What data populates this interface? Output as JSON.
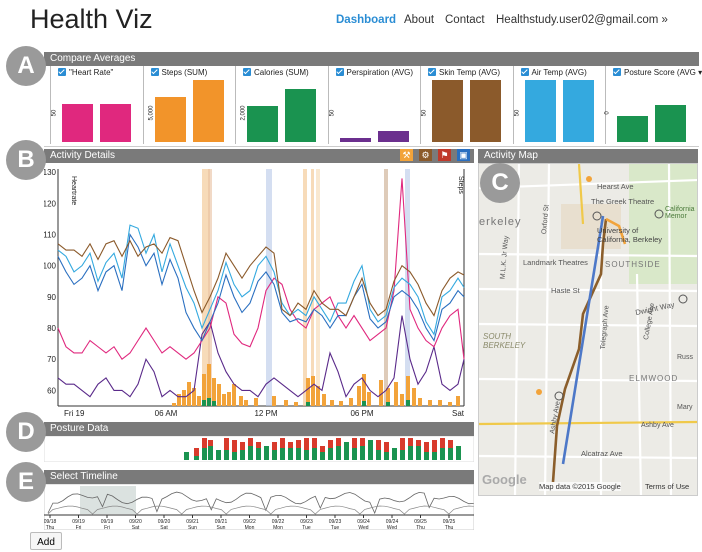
{
  "app": {
    "title": "Health Viz"
  },
  "nav": {
    "dashboard": "Dashboard",
    "about": "About",
    "contact": "Contact",
    "user": "Healthstudy.user02@gmail.com »"
  },
  "sections": {
    "A": "A",
    "B": "B",
    "C": "C",
    "D": "D",
    "E": "E"
  },
  "compare": {
    "header": "Compare Averages",
    "metrics": [
      {
        "label": "\"Heart Rate\"",
        "color": "#e0287e",
        "values": [
          0.62,
          0.62
        ]
      },
      {
        "label": "Steps (SUM)",
        "color": "#f2942a",
        "values": [
          0.72,
          1.0
        ]
      },
      {
        "label": "Calories (SUM)",
        "color": "#1a9350",
        "values": [
          0.58,
          0.85
        ]
      },
      {
        "label": "Perspiration (AVG)",
        "color": "#6b2f8e",
        "values": [
          0.06,
          0.18
        ]
      },
      {
        "label": "Skin Temp (AVG)",
        "color": "#8b5a2b",
        "values": [
          1.0,
          1.0
        ]
      },
      {
        "label": "Air Temp (AVG)",
        "color": "#34a9df",
        "values": [
          1.0,
          1.0
        ]
      },
      {
        "label": "Posture Score (AVG ▾",
        "color": "#1a9350",
        "values": [
          0.42,
          0.6
        ]
      }
    ],
    "axis_ticks": [
      "50",
      "5,000",
      "2,000",
      "50",
      "50",
      "50",
      "0"
    ]
  },
  "activity": {
    "header": "Activity Details",
    "left_axis_label": "Heartrate",
    "right_axis_label": "Steps",
    "y_ticks": [
      "130",
      "120",
      "110",
      "100",
      "90",
      "80",
      "70",
      "60"
    ],
    "x_ticks": [
      "Fri 19",
      "06 AM",
      "12 PM",
      "06 PM",
      "Sat"
    ],
    "activity_icons": [
      {
        "name": "walk-icon",
        "glyph": "⚒",
        "color": "#f2a33a"
      },
      {
        "name": "bike-icon",
        "glyph": "⚙",
        "color": "#8b5a2b"
      },
      {
        "name": "run-icon",
        "glyph": "⚑",
        "color": "#c0392b"
      },
      {
        "name": "car-icon",
        "glyph": "▣",
        "color": "#2a6fc0"
      }
    ]
  },
  "map": {
    "header": "Activity Map",
    "labels": [
      "Hearst Ave",
      "The Greek Theatre",
      "Oxford St",
      "University of California, Berkeley",
      "California Memor",
      "Landmark Theatres",
      "SOUTHSIDE",
      "erkeley",
      "M.L.K. Jr Way",
      "Haste St",
      "Dwight Way",
      "College Ave",
      "Telegraph Ave",
      "SOUTH BERKELEY",
      "ELMWOOD",
      "Alcatraz Ave",
      "Ashby Ave",
      "Russ",
      "Mary",
      "Ashby Ave"
    ],
    "attribution": "Map data ©2015 Google",
    "terms": "Terms of Use",
    "logo": "Google"
  },
  "posture": {
    "header": "Posture Data"
  },
  "timeline": {
    "header": "Select Timeline",
    "dates": [
      {
        "d": "09/18",
        "w": "Thu"
      },
      {
        "d": "09/19",
        "w": "Fri"
      },
      {
        "d": "09/19",
        "w": "Fri"
      },
      {
        "d": "09/20",
        "w": "Sat"
      },
      {
        "d": "09/20",
        "w": "Sat"
      },
      {
        "d": "09/21",
        "w": "Sun"
      },
      {
        "d": "09/21",
        "w": "Sun"
      },
      {
        "d": "09/22",
        "w": "Mon"
      },
      {
        "d": "09/22",
        "w": "Mon"
      },
      {
        "d": "09/23",
        "w": "Tue"
      },
      {
        "d": "09/23",
        "w": "Tue"
      },
      {
        "d": "09/24",
        "w": "Wed"
      },
      {
        "d": "09/24",
        "w": "Wed"
      },
      {
        "d": "09/25",
        "w": "Thu"
      },
      {
        "d": "09/25",
        "w": "Thu"
      }
    ]
  },
  "add_button": "Add"
}
